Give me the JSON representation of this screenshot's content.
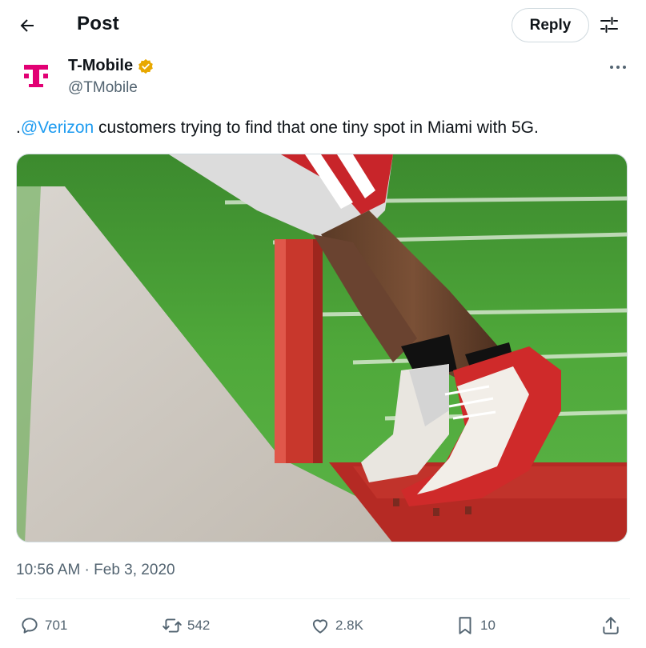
{
  "header": {
    "back_icon": "arrow-left-icon",
    "title": "Post",
    "reply_label": "Reply",
    "adjust_icon": "sliders-icon"
  },
  "author": {
    "name": "T-Mobile",
    "handle": "@TMobile",
    "verified": true,
    "verified_color": "#e8a800",
    "brand_color": "#e20074",
    "logo_letter": "T"
  },
  "tweet": {
    "prefix": ".",
    "mention": "@Verizon",
    "body": " customers trying to find that one tiny spot in Miami with 5G.",
    "mention_color": "#1d9bf0"
  },
  "media": {
    "description_icon": "photo"
  },
  "timestamp": "10:56 AM · Feb 3, 2020",
  "actions": {
    "replies": "701",
    "reposts": "542",
    "likes": "2.8K",
    "bookmarks": "10"
  }
}
